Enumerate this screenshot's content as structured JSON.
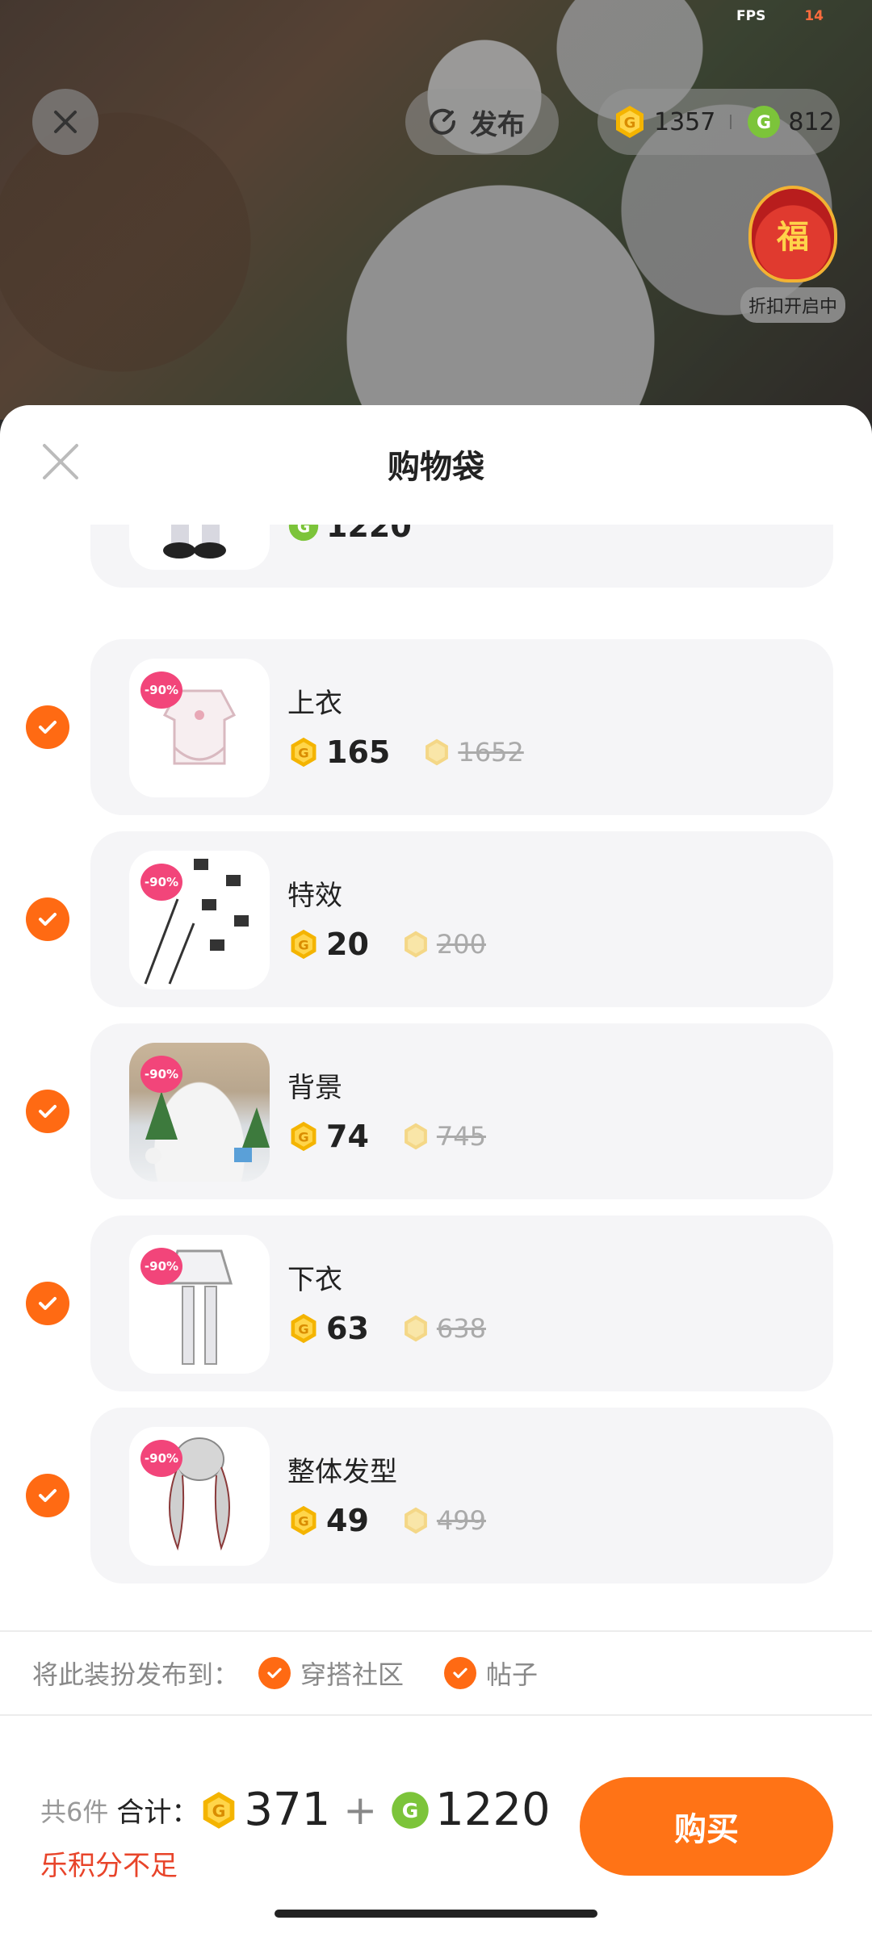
{
  "status": {
    "fps_label": "FPS",
    "fps_value": "14"
  },
  "topbar": {
    "publish_label": "发布",
    "gold_coin_balance": "1357",
    "green_coin_balance": "812",
    "discount_label": "折扣开启中",
    "fortune_char": "福"
  },
  "sheet": {
    "title": "购物袋"
  },
  "items": [
    {
      "name": "",
      "currency": "green",
      "price": "1220",
      "original_price": "",
      "sale_tag": ""
    },
    {
      "name": "上衣",
      "currency": "gold",
      "price": "165",
      "original_price": "1652",
      "sale_tag": "-90%"
    },
    {
      "name": "特效",
      "currency": "gold",
      "price": "20",
      "original_price": "200",
      "sale_tag": "-90%"
    },
    {
      "name": "背景",
      "currency": "gold",
      "price": "74",
      "original_price": "745",
      "sale_tag": "-90%"
    },
    {
      "name": "下衣",
      "currency": "gold",
      "price": "63",
      "original_price": "638",
      "sale_tag": "-90%"
    },
    {
      "name": "整体发型",
      "currency": "gold",
      "price": "49",
      "original_price": "499",
      "sale_tag": "-90%"
    }
  ],
  "publish": {
    "label": "将此装扮发布到：",
    "options": [
      "穿搭社区",
      "帖子"
    ]
  },
  "footer": {
    "count_text": "共6件",
    "total_label": "合计：",
    "gold_total": "371",
    "plus": "+",
    "green_total": "1220",
    "warning": "乐积分不足",
    "buy_label": "购买"
  },
  "colors": {
    "accent": "#ff7316",
    "check": "#ff6a13",
    "warning": "#e8442a",
    "gold_coin": "#f4b400",
    "green_coin": "#7cc43a",
    "sale_tag": "#f2457a"
  },
  "icons": {
    "close": "close-icon",
    "publish": "refresh-arrow-icon",
    "gold": "gold-coin-icon",
    "green": "green-coin-icon",
    "check": "checkmark-icon"
  }
}
